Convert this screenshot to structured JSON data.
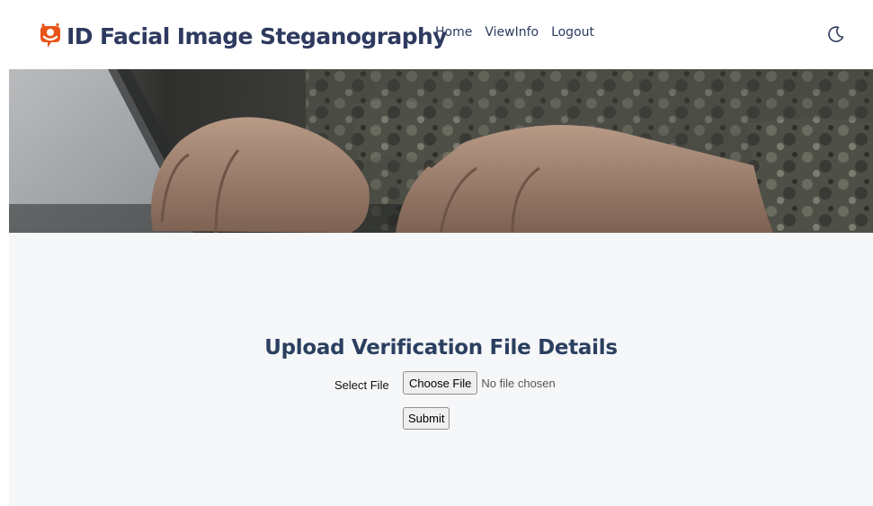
{
  "brand": {
    "title": "ID Facial Image Steganography",
    "logo_icon": "face-bubble-icon",
    "logo_color": "#e8551b"
  },
  "nav": {
    "items": [
      {
        "label": "Home"
      },
      {
        "label": "ViewInfo"
      },
      {
        "label": "Logout"
      }
    ],
    "theme_icon": "moon-icon"
  },
  "hero": {
    "image": "hands-typing-on-laptop-camouflage-sleeves"
  },
  "form": {
    "title": "Upload Verification File Details",
    "file_label": "Select File",
    "file_button_label": "Choose File",
    "file_status": "No file chosen",
    "submit_label": "Submit"
  },
  "colors": {
    "brand_text": "#2e3a5f",
    "content_bg": "#f6f7f9",
    "title_text": "#2b4060"
  }
}
